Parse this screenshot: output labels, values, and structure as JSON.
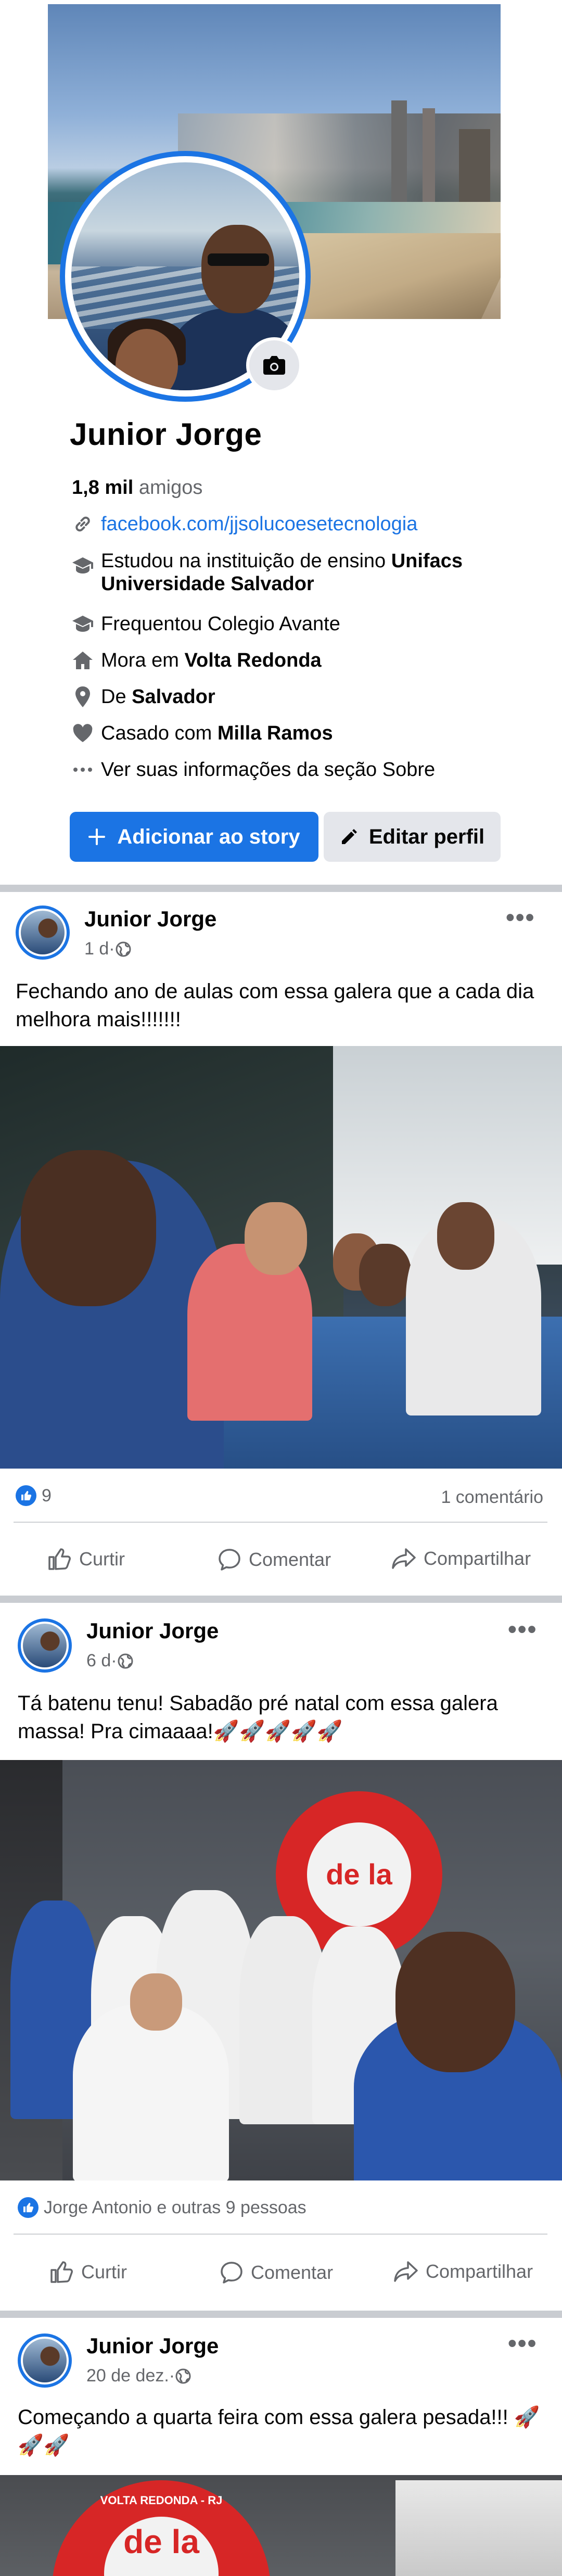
{
  "profile": {
    "name": "Junior Jorge",
    "friends_count": "1,8 mil",
    "friends_label": "amigos",
    "link": "facebook.com/jjsolucoesetecnologia",
    "education_prefix": "Estudou na instituição de ensino ",
    "education_school": "Unifacs Universidade Salvador",
    "attended": "Frequentou Colegio Avante",
    "lives_prefix": "Mora em ",
    "lives_city": "Volta Redonda",
    "from_prefix": "De ",
    "from_city": "Salvador",
    "married_prefix": "Casado com ",
    "married_name": "Milla Ramos",
    "about_link": "Ver suas informações da seção Sobre",
    "add_story_label": "Adicionar ao story",
    "edit_profile_label": "Editar perfil"
  },
  "posts": [
    {
      "author": "Junior Jorge",
      "time": "1 d",
      "text": "Fechando ano de aulas com essa galera que a cada dia melhora mais!!!!!!!",
      "reactions": "9",
      "comments": "1 comentário"
    },
    {
      "author": "Junior Jorge",
      "time": "6 d",
      "text": "Tá batenu tenu! Sabadão pré natal com essa galera massa! Pra cimaaaa!🚀🚀🚀🚀🚀",
      "reactions": "Jorge Antonio e outras 9 pessoas"
    },
    {
      "author": "Junior Jorge",
      "time": "20 de dez.",
      "text": "Começando a quarta feira com essa galera pesada!!! 🚀🚀🚀"
    }
  ],
  "actions": {
    "like": "Curtir",
    "comment": "Comentar",
    "share": "Compartilhar"
  },
  "meta_separator": " · ",
  "photo_signs": {
    "sign1": "de la",
    "sign2": "VOLTA REDONDA - RJ",
    "sign3": "de la"
  },
  "colors": {
    "primary": "#1b74e4",
    "secondary_text": "#65676b",
    "button_gray": "#e4e6eb"
  }
}
